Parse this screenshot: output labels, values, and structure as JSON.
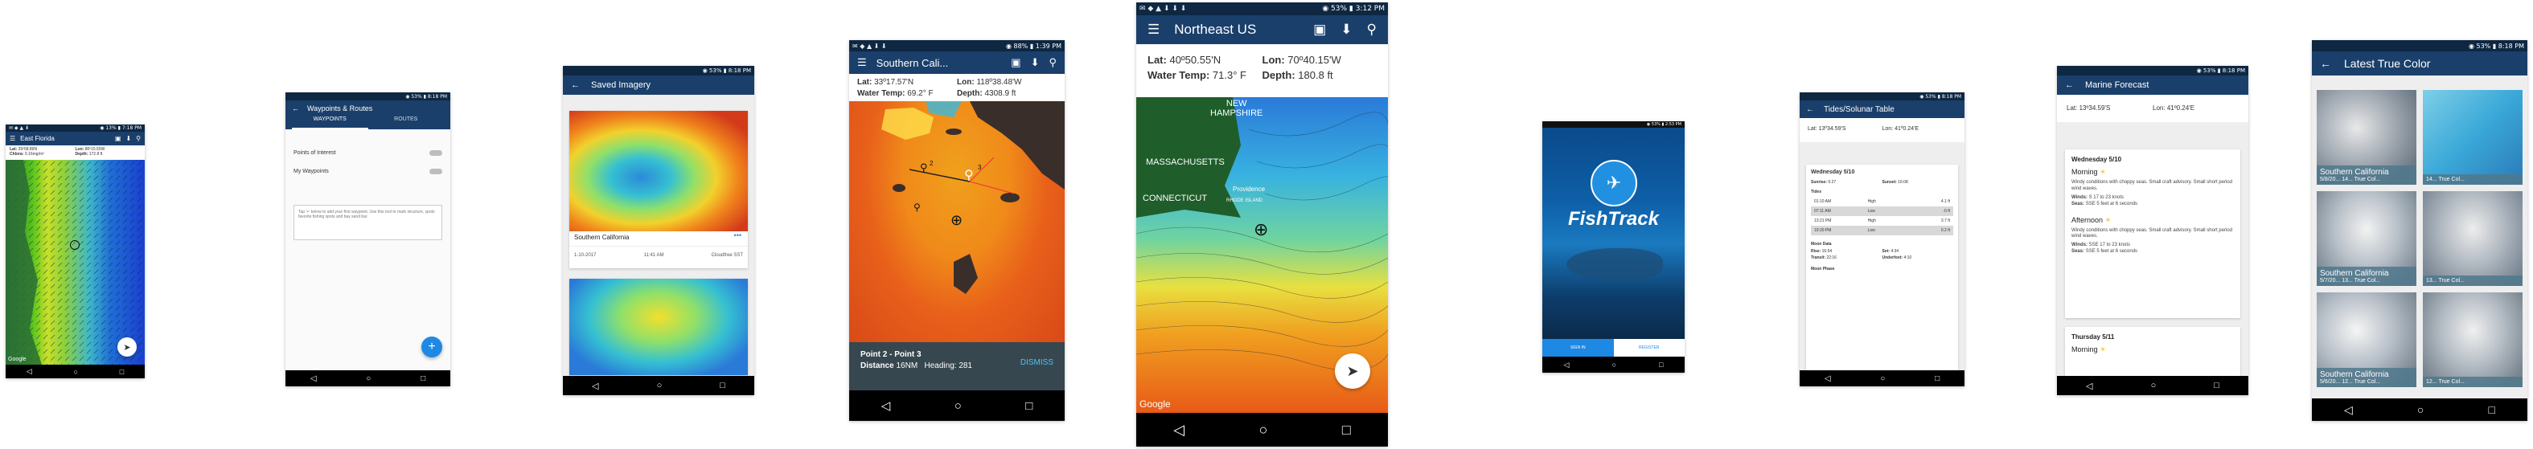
{
  "colors": {
    "status_bar": "#0e2742",
    "app_bar": "#1a3f6b",
    "accent": "#1e88e5",
    "sea_warm": "#f08a1a",
    "sea_cool": "#2aa6d8"
  },
  "phone1": {
    "status": "◉ 13% ▮ 7:18 PM",
    "title": "East Florida",
    "lat": "Lat:",
    "lat_val": "29º58.89N",
    "lon": "Lon:",
    "lon_val": "80º15.55W",
    "chlor": "Chlora:",
    "chlor_val": "0.16mg/m³",
    "depth": "Depth:",
    "depth_val": "172.8 ft",
    "google": "Google"
  },
  "phone2": {
    "status": "◉ 53% ▮ 8:18 PM",
    "title": "Waypoints & Routes",
    "tabs": [
      "WAYPOINTS",
      "ROUTES"
    ],
    "items": [
      "Points of Interest",
      "My Waypoints"
    ],
    "hint": "Tap '+' below to add your first waypoint. Use this tool to mark structure, spots favorite fishing spots and bay sand bar.",
    "fab": "+"
  },
  "phone3": {
    "status": "◉ 53% ▮ 8:18 PM",
    "title": "Saved Imagery",
    "card1_title": "Southern California",
    "card1_date": "1-10-2017",
    "card1_time": "11:41 AM",
    "card1_type": "Cloudfree SST",
    "more": "•••"
  },
  "phone4": {
    "status": "◉ 88% ▮ 1:39 PM",
    "title": "Southern Cali...",
    "lat": "Lat:",
    "lat_val": "33º17.57'N",
    "lon": "Lon:",
    "lon_val": "118º38.48'W",
    "temp": "Water Temp:",
    "temp_val": "69.2° F",
    "depth": "Depth:",
    "depth_val": "4308.9 ft",
    "route_label": "Point 2 - Point 3",
    "distance": "Distance",
    "distance_val": "16NM",
    "heading": "Heading:",
    "heading_val": "281",
    "dismiss": "DISMISS",
    "wp1": "2",
    "wp2": "3"
  },
  "phone5": {
    "status": "◉ 53% ▮ 3:12 PM",
    "title": "Northeast US",
    "lat": "Lat:",
    "lat_val": "40º50.55'N",
    "lon": "Lon:",
    "lon_val": "70º40.15'W",
    "temp": "Water Temp:",
    "temp_val": "71.3° F",
    "depth": "Depth:",
    "depth_val": "180.8 ft",
    "labels": {
      "nh": "NEW\nHAMPSHIRE",
      "ma": "MASSACHUSETTS",
      "ct": "CONNECTICUT",
      "prov": "Providence",
      "ri": "RHODE ISLAND"
    },
    "google": "Google"
  },
  "phone6": {
    "status": "◉ 53% ▮ 2:53 PM",
    "brand": "FishTrack",
    "sign_in": "SIGN IN",
    "register": "REGISTER"
  },
  "phone7": {
    "status": "◉ 53% ▮ 8:18 PM",
    "title": "Tides/Solunar Table",
    "lat": "Lat:",
    "lat_val": "13º34.59'S",
    "lon": "Lon:",
    "lon_val": "41º0.24'E",
    "day": "Wednesday 5/10",
    "sunrise": "Sunrise:",
    "sunrise_val": "5:27",
    "sunset": "Sunset:",
    "sunset_val": "16:08",
    "tides_label": "Tides",
    "tides": [
      {
        "t": "01:10 AM",
        "k": "High",
        "v": "4.1 ft"
      },
      {
        "t": "07:11 AM",
        "k": "Low",
        "v": "-0 ft"
      },
      {
        "t": "13:21 PM",
        "k": "High",
        "v": "3.7 ft"
      },
      {
        "t": "19:20 PM",
        "k": "Low",
        "v": "0.2 ft"
      }
    ],
    "moon_label": "Moon Data",
    "rise": "Rise:",
    "rise_val": "16:54",
    "set": "Set:",
    "set_val": "4:34",
    "transit": "Transit:",
    "transit_val": "22:16",
    "under": "Underfoot:",
    "under_val": "4:10",
    "phase_label": "Moon Phase"
  },
  "phone8": {
    "status": "◉ 53% ▮ 8:18 PM",
    "title": "Marine Forecast",
    "lat": "Lat:",
    "lat_val": "13º34.59'S",
    "lon": "Lon:",
    "lon_val": "41º0.24'E",
    "day1": "Wednesday 5/10",
    "morning": "Morning",
    "m_text": "Windy conditions with choppy seas. Small craft advisory. Small short period wind waves.",
    "winds": "Winds:",
    "m_winds": "S 17 to 23 knots",
    "seas": "Seas:",
    "m_seas": "SSE 5 feet at 6 seconds",
    "afternoon": "Afternoon",
    "a_text": "Windy conditions with choppy seas. Small craft advisory. Small short period wind waves.",
    "a_winds": "SSE 17 to 23 knots",
    "a_seas": "SSE 5 feet at 6 seconds",
    "day2": "Thursday 5/11",
    "morning2": "Morning"
  },
  "phone9": {
    "status": "◉ 53% ▮ 8:18 PM",
    "title": "Latest True Color",
    "tiles": [
      {
        "name": "Southern California",
        "meta": "5/8/20... 14... True Col..."
      },
      {
        "name": "",
        "meta": "14... True Col..."
      },
      {
        "name": "Southern California",
        "meta": "5/7/20... 13... True Col..."
      },
      {
        "name": "",
        "meta": "13... True Col..."
      },
      {
        "name": "Southern California",
        "meta": "5/6/20... 12... True Col..."
      },
      {
        "name": "",
        "meta": "12... True Col..."
      }
    ]
  }
}
